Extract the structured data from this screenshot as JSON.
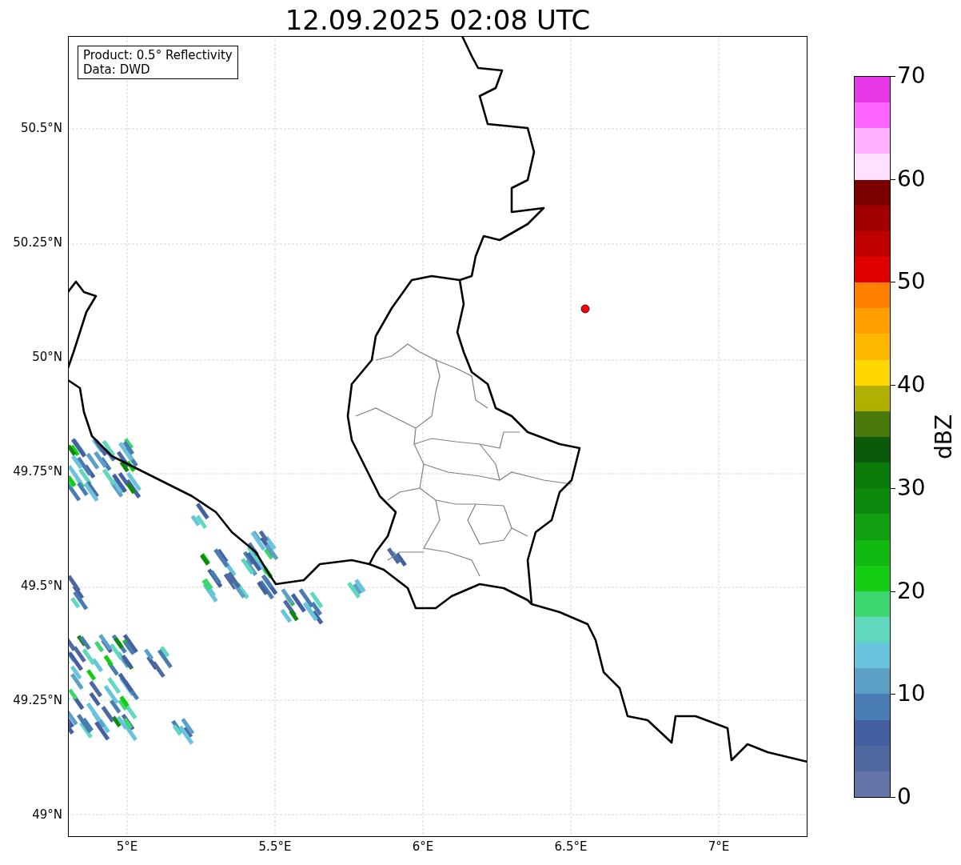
{
  "title": "12.09.2025 02:08 UTC",
  "info_box": [
    "Product: 0.5° Reflectivity",
    "Data: DWD"
  ],
  "lat_ticks": [
    "50.5°N",
    "50.25°N",
    "50°N",
    "49.75°N",
    "49.5°N",
    "49.25°N",
    "49°N"
  ],
  "lon_ticks": [
    "5°E",
    "5.5°E",
    "6°E",
    "6.5°E",
    "7°E"
  ],
  "colorbar": {
    "label": "dBZ",
    "ticks": [
      "70",
      "60",
      "50",
      "40",
      "30",
      "20",
      "10",
      "0"
    ],
    "bands": [
      {
        "color": "#6474a8"
      },
      {
        "color": "#5068a0"
      },
      {
        "color": "#4460a0"
      },
      {
        "color": "#4a7cb4"
      },
      {
        "color": "#5ca0c8"
      },
      {
        "color": "#68c4dc"
      },
      {
        "color": "#60d8c0"
      },
      {
        "color": "#3ed66e"
      },
      {
        "color": "#14cc14"
      },
      {
        "color": "#12b812"
      },
      {
        "color": "#10a010"
      },
      {
        "color": "#0d8a0d"
      },
      {
        "color": "#0a7a0a"
      },
      {
        "color": "#0a5a0a"
      },
      {
        "color": "#4a7a0a"
      },
      {
        "color": "#b0b000"
      },
      {
        "color": "#ffd700"
      },
      {
        "color": "#ffb800"
      },
      {
        "color": "#ff9f00"
      },
      {
        "color": "#ff7f00"
      },
      {
        "color": "#e00000"
      },
      {
        "color": "#c00000"
      },
      {
        "color": "#a00000"
      },
      {
        "color": "#7a0000"
      },
      {
        "color": "#ffe0ff"
      },
      {
        "color": "#ffb0ff"
      },
      {
        "color": "#ff66ff"
      },
      {
        "color": "#e838e8"
      }
    ]
  }
}
